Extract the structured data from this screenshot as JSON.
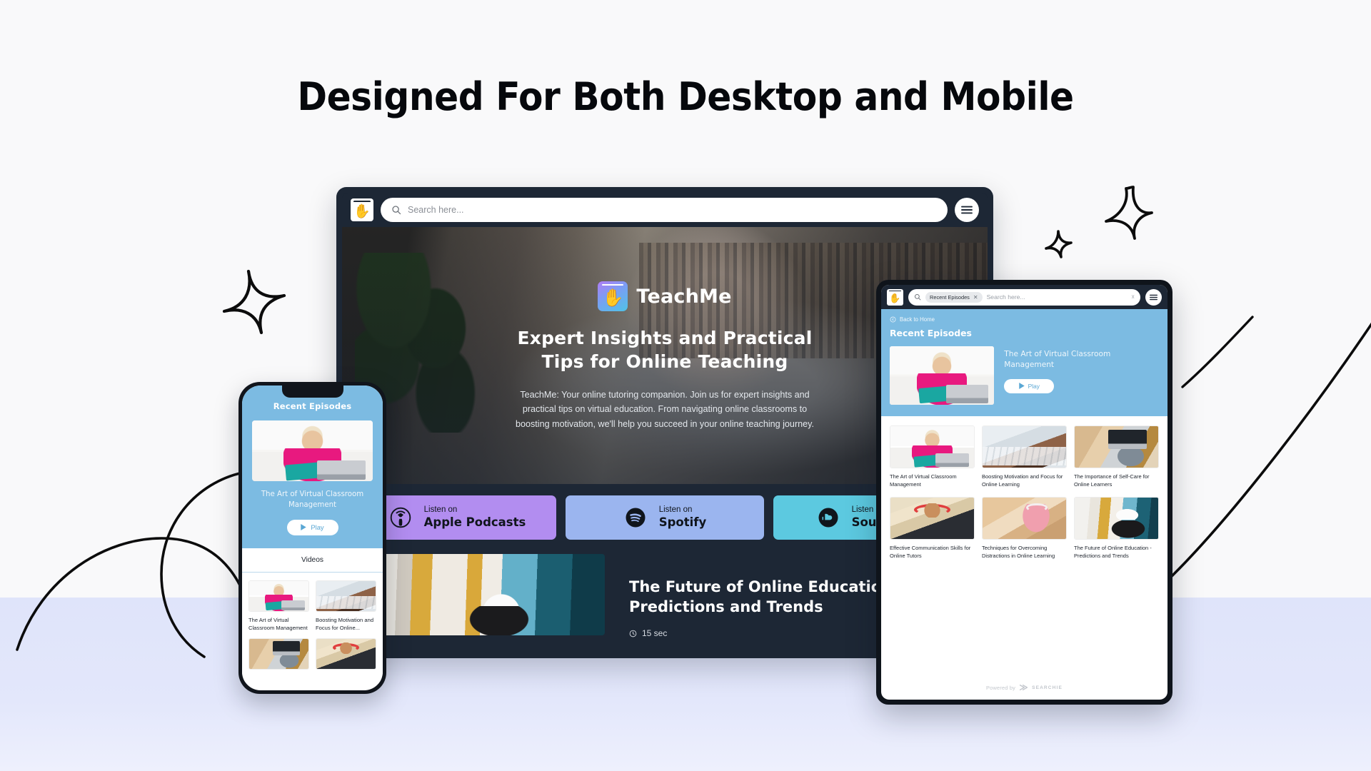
{
  "headline": "Designed For Both Desktop and Mobile",
  "colors": {
    "page_bg": "#f9f9fa",
    "bottom_band": "#dfe4fa",
    "device_dark": "#1d2735",
    "brand_blue": "#7cbbe2",
    "apple_podcasts": "#b28df0",
    "spotify": "#9bb5ef",
    "soundcloud": "#5cc9e0",
    "play_text": "#5aa7d4"
  },
  "desktop": {
    "topbar": {
      "logo_icon": "teachme-book-hand-icon",
      "search_icon": "search-icon",
      "search_placeholder": "Search here...",
      "search_value": "",
      "menu_icon": "hamburger-menu-icon"
    },
    "hero": {
      "brand_icon": "teachme-logo-icon",
      "brand_name": "TeachMe",
      "title_line1": "Expert Insights and Practical",
      "title_line2": "Tips for Online Teaching",
      "description": "TeachMe: Your online tutoring companion. Join us for expert insights and practical tips on virtual education. From navigating online classrooms to boosting motivation, we'll help you succeed in your online teaching journey."
    },
    "platforms": [
      {
        "icon": "apple-podcasts-icon",
        "small": "Listen on",
        "big": "Apple Podcasts",
        "color": "#b28df0"
      },
      {
        "icon": "spotify-icon",
        "small": "Listen on",
        "big": "Spotify",
        "color": "#9bb5ef"
      },
      {
        "icon": "soundcloud-icon",
        "small": "Listen on",
        "big": "Soundcloud",
        "color": "#5cc9e0"
      }
    ],
    "featured": {
      "title_line1": "The Future of Online Education -",
      "title_line2": "Predictions and Trends",
      "duration_icon": "clock-icon",
      "duration": "15 sec"
    }
  },
  "phone": {
    "hero_title": "Recent Episodes",
    "episode_title": "The Art of Virtual Classroom Management",
    "play_icon": "play-triangle-icon",
    "play_label": "Play",
    "videos_header": "Videos",
    "videos": [
      {
        "title": "The Art of Virtual Classroom Management",
        "art": "img-woman-laptop"
      },
      {
        "title": "Boosting Motivation and Focus for Online...",
        "art": "img-keyboard"
      },
      {
        "title": "",
        "art": "img-selfcare"
      },
      {
        "title": "",
        "art": "img-headphones"
      }
    ]
  },
  "tablet": {
    "topbar": {
      "logo_icon": "teachme-book-hand-icon",
      "search_icon": "search-icon",
      "chip_label": "Recent Episodes",
      "chip_remove_icon": "close-x-icon",
      "search_placeholder": "Search here...",
      "clear_icon": "clear-field-icon",
      "menu_icon": "hamburger-menu-icon"
    },
    "back_icon": "back-circle-arrow-icon",
    "back_label": "Back to Home",
    "section_title": "Recent Episodes",
    "featured": {
      "title": "The Art of Virtual Classroom Management",
      "play_icon": "play-triangle-icon",
      "play_label": "Play"
    },
    "videos": [
      {
        "title": "The Art of Virtual Classroom Management",
        "art": "img-woman-laptop"
      },
      {
        "title": "Boosting Motivation and Focus for Online Learning",
        "art": "img-keyboard"
      },
      {
        "title": "The Importance of Self-Care for Online Learners",
        "art": "img-selfcare"
      },
      {
        "title": "Effective Communication Skills for Online Tutors",
        "art": "img-headphones"
      },
      {
        "title": "Techniques for Overcoming Distractions in Online Learning",
        "art": "img-pink-girl"
      },
      {
        "title": "The Future of Online Education - Predictions and Trends",
        "art": "img-cap-guy"
      }
    ],
    "footer": {
      "prefix": "Powered by",
      "logo_icon": "searchie-logo-icon",
      "brand": "SEARCHIE"
    }
  },
  "decorations": [
    {
      "name": "sparkle-large-right",
      "type": "sparkle"
    },
    {
      "name": "sparkle-small-right",
      "type": "sparkle"
    },
    {
      "name": "sparkle-left",
      "type": "sparkle"
    },
    {
      "name": "arc-left-large",
      "type": "arc"
    },
    {
      "name": "arc-left-small",
      "type": "arc"
    },
    {
      "name": "diagonal-line-long",
      "type": "line"
    },
    {
      "name": "diagonal-line-short",
      "type": "line"
    }
  ]
}
